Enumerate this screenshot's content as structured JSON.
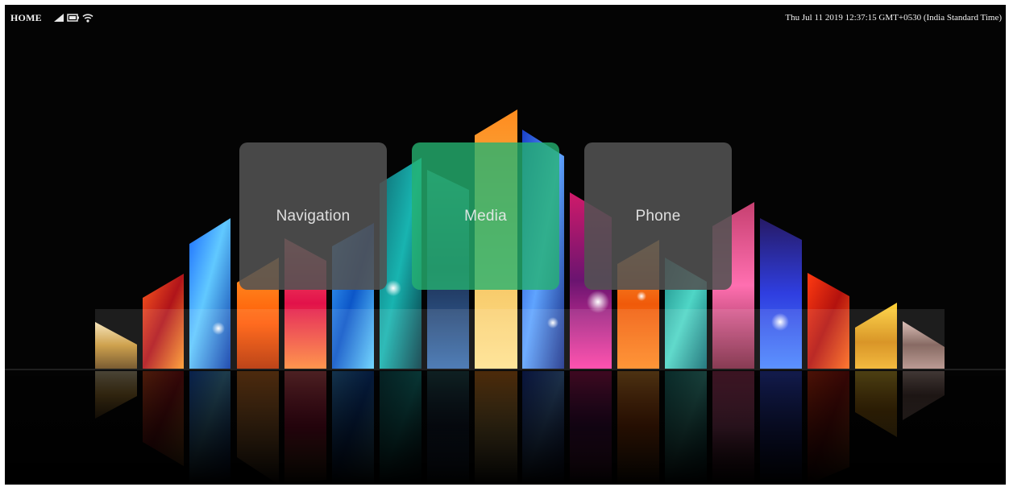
{
  "status_bar": {
    "home_label": "HOME",
    "icons": [
      "signal-icon",
      "battery-icon",
      "wifi-icon"
    ],
    "datetime": "Thu Jul 11 2019 12:37:15 GMT+0530 (India Standard Time)"
  },
  "menu": {
    "tiles": [
      {
        "label": "Navigation",
        "active": false
      },
      {
        "label": "Media",
        "active": true
      },
      {
        "label": "Phone",
        "active": false
      }
    ]
  },
  "colors": {
    "background": "#040404",
    "tile_inactive": "#525252",
    "tile_active": "#26b270",
    "text": "#f2f2f2"
  }
}
